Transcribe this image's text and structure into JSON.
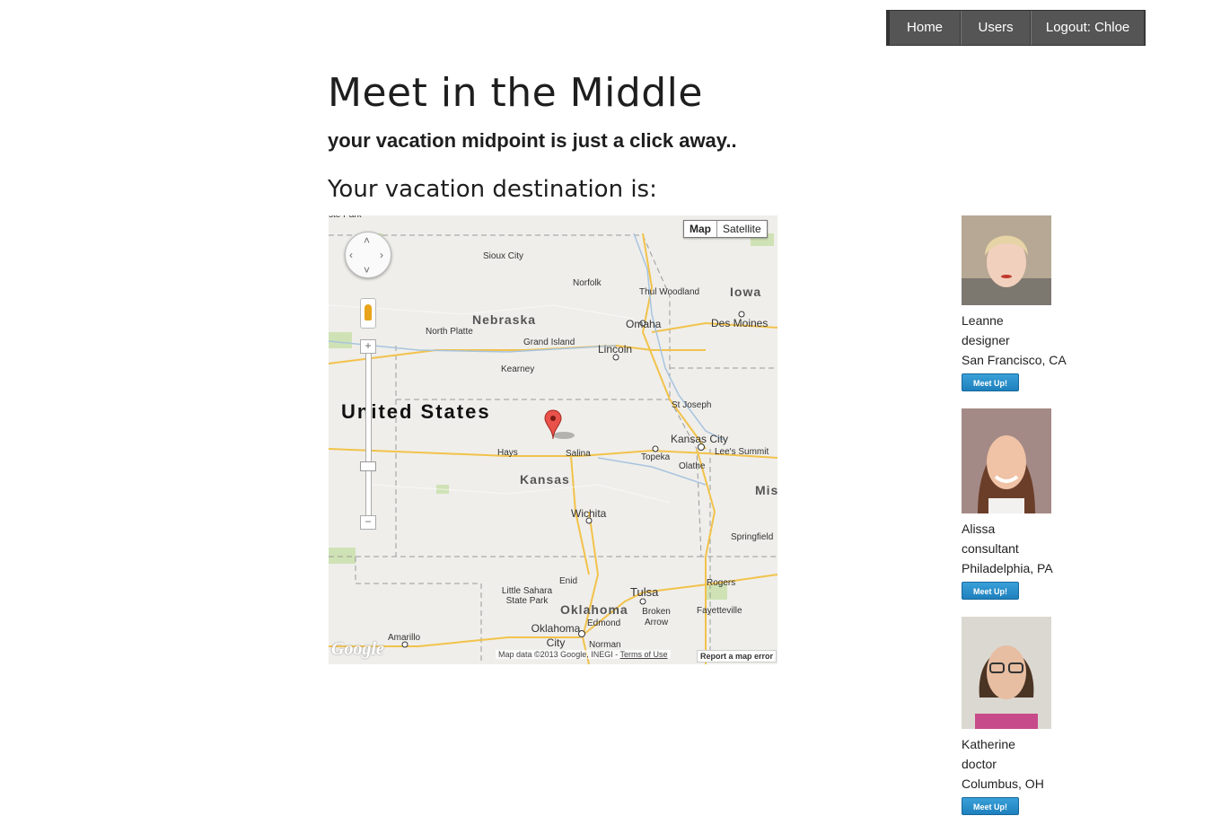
{
  "nav": {
    "home": "Home",
    "users": "Users",
    "logout": "Logout: Chloe"
  },
  "page": {
    "title": "Meet in the Middle",
    "subtitle": "your vacation midpoint is just a click away..",
    "destination_heading": "Your vacation destination is:"
  },
  "map": {
    "type_map": "Map",
    "type_satellite": "Satellite",
    "country": "United States",
    "states": [
      "Nebraska",
      "Iowa",
      "Kansas",
      "Oklahoma",
      "Mis"
    ],
    "cities": [
      "Sioux City",
      "Norfolk",
      "Thul Woodland",
      "Omaha",
      "Des Moines",
      "North Platte",
      "Grand Island",
      "Lincoln",
      "Kearney",
      "St Joseph",
      "Kansas City",
      "Lee's Summit",
      "Hays",
      "Salina",
      "Topeka",
      "Olathe",
      "Wichita",
      "Springfield",
      "Little Sahara State Park",
      "Enid",
      "Tulsa",
      "Rogers",
      "Broken Arrow",
      "Fayetteville",
      "Edmond",
      "Oklahoma City",
      "Amarillo",
      "Norman",
      "ste Park"
    ],
    "zoom_in": "+",
    "zoom_out": "−",
    "logo": "Google",
    "attribution": "Map data ©2013 Google, INEGI - ",
    "terms": "Terms of Use",
    "report": "Report a map error"
  },
  "users": [
    {
      "name": "Leanne",
      "job": "designer",
      "location": "San Francisco, CA",
      "button": "Meet Up!",
      "photo_bg": "#b6a894",
      "hair": "#e6d3a6",
      "skin": "#f1d0bd"
    },
    {
      "name": "Alissa",
      "job": "consultant",
      "location": "Philadelphia, PA",
      "button": "Meet Up!",
      "photo_bg": "#a48a86",
      "hair": "#6b3e2a",
      "skin": "#f0c3a6"
    },
    {
      "name": "Katherine",
      "job": "doctor",
      "location": "Columbus, OH",
      "button": "Meet Up!",
      "photo_bg": "#dbd8d1",
      "hair": "#4a3424",
      "skin": "#e7bea2"
    }
  ]
}
